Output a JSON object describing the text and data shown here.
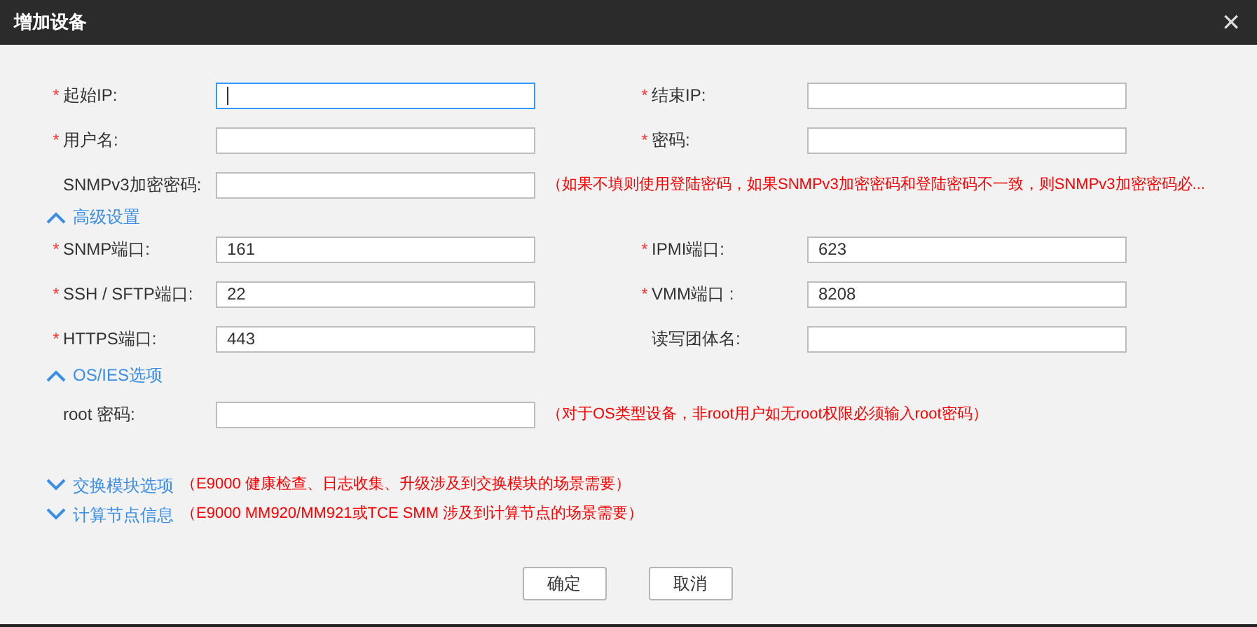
{
  "window": {
    "title": "增加设备",
    "close": "×"
  },
  "items": [
    {
      "kind": "pair",
      "fields": [
        {
          "label": "起始IP:",
          "required_mark": "*",
          "focused": true
        },
        {
          "label": "结束IP:",
          "required_mark": "*",
          "focused": false
        }
      ]
    },
    {
      "kind": "pair",
      "fields": [
        {
          "label": "用户名:",
          "required_mark": "*",
          "focused": false
        },
        {
          "label": "密码:",
          "required_mark": "*",
          "focused": false
        }
      ]
    },
    {
      "kind": "single",
      "field": {
        "label": "SNMPv3加密密码:",
        "focused": false
      },
      "note": "（如果不填则使用登陆密码，如果SNMPv3加密密码和登陆密码不一致，则SNMPv3加密密码必..."
    },
    {
      "kind": "section",
      "label": "高级设置",
      "expanded": true
    },
    {
      "kind": "pair",
      "fields": [
        {
          "label": "SNMP端口:",
          "required_mark": "*",
          "value": "161",
          "focused": false
        },
        {
          "label": "IPMI端口:",
          "required_mark": "*",
          "value": "623",
          "focused": false
        }
      ]
    },
    {
      "kind": "pair",
      "fields": [
        {
          "label": "SSH / SFTP端口:",
          "required_mark": "*",
          "value": "22",
          "focused": false
        },
        {
          "label": "VMM端口 :",
          "required_mark": "*",
          "value": "8208",
          "focused": false
        }
      ]
    },
    {
      "kind": "pair",
      "fields": [
        {
          "label": "HTTPS端口:",
          "required_mark": "*",
          "value": "443",
          "focused": false
        },
        {
          "label": "读写团体名:",
          "focused": false
        }
      ]
    },
    {
      "kind": "section",
      "label": "OS/IES选项",
      "expanded": true
    },
    {
      "kind": "single",
      "field": {
        "label": "root 密码:",
        "focused": false
      },
      "note": "（对于OS类型设备，非root用户如无root权限必须输入root密码）"
    }
  ],
  "extra_sections": [
    {
      "label": "交换模块选项",
      "expanded": false,
      "note": "（E9000 健康检查、日志收集、升级涉及到交换模块的场景需要）"
    },
    {
      "label": "计算节点信息",
      "expanded": false,
      "note": "（E9000 MM920/MM921或TCE SMM 涉及到计算节点的场景需要）"
    }
  ],
  "buttons": [
    "确定",
    "取消"
  ]
}
